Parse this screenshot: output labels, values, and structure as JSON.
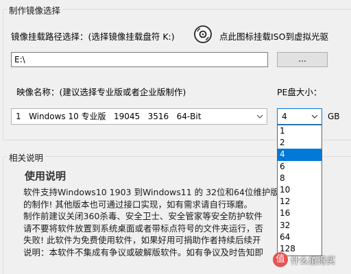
{
  "image_group": {
    "title": "制作镜像选择",
    "path_label": "镜像挂载路径选择：(选择镜像挂载盘符 K:)",
    "mount_hint": "点此图标挂载ISO到虚拟光驱",
    "path_value": "E:\\",
    "browse_label": "...",
    "name_label": "映像名称：(建议选择专业版或者企业版制作)",
    "pe_size_label": "PE盘大小：",
    "image_selected": "1   Windows 10 专业版   19045   3516   64-Bit",
    "pe_size_selected": "4",
    "pe_unit": "GB",
    "pe_size_options": [
      "1",
      "2",
      "4",
      "6",
      "8",
      "10",
      "12",
      "16",
      "32",
      "64",
      "128"
    ],
    "pe_size_highlighted_index": 2
  },
  "help_group": {
    "title": "相关说明",
    "heading": "使用说明",
    "lines": [
      "软件支持Windows10 1903 到Windows11 的 32位和64位维护版本",
      "的制作! 其他版本也可通过接口实现，如有需求请自行琢磨。",
      "制作前建议关闭360杀毒、安全卫士、安全管家等安全防护软件",
      "请不要将软件放置到系统桌面或者带标点符号的文件夹运行，否",
      "失败! 此软件为免费使用软件，如果好用可捐助作者持续后续开",
      "说明：本软件不集成有争议或破解版软件。如有争议及时告知即"
    ]
  },
  "watermark": "值 什么值得买"
}
